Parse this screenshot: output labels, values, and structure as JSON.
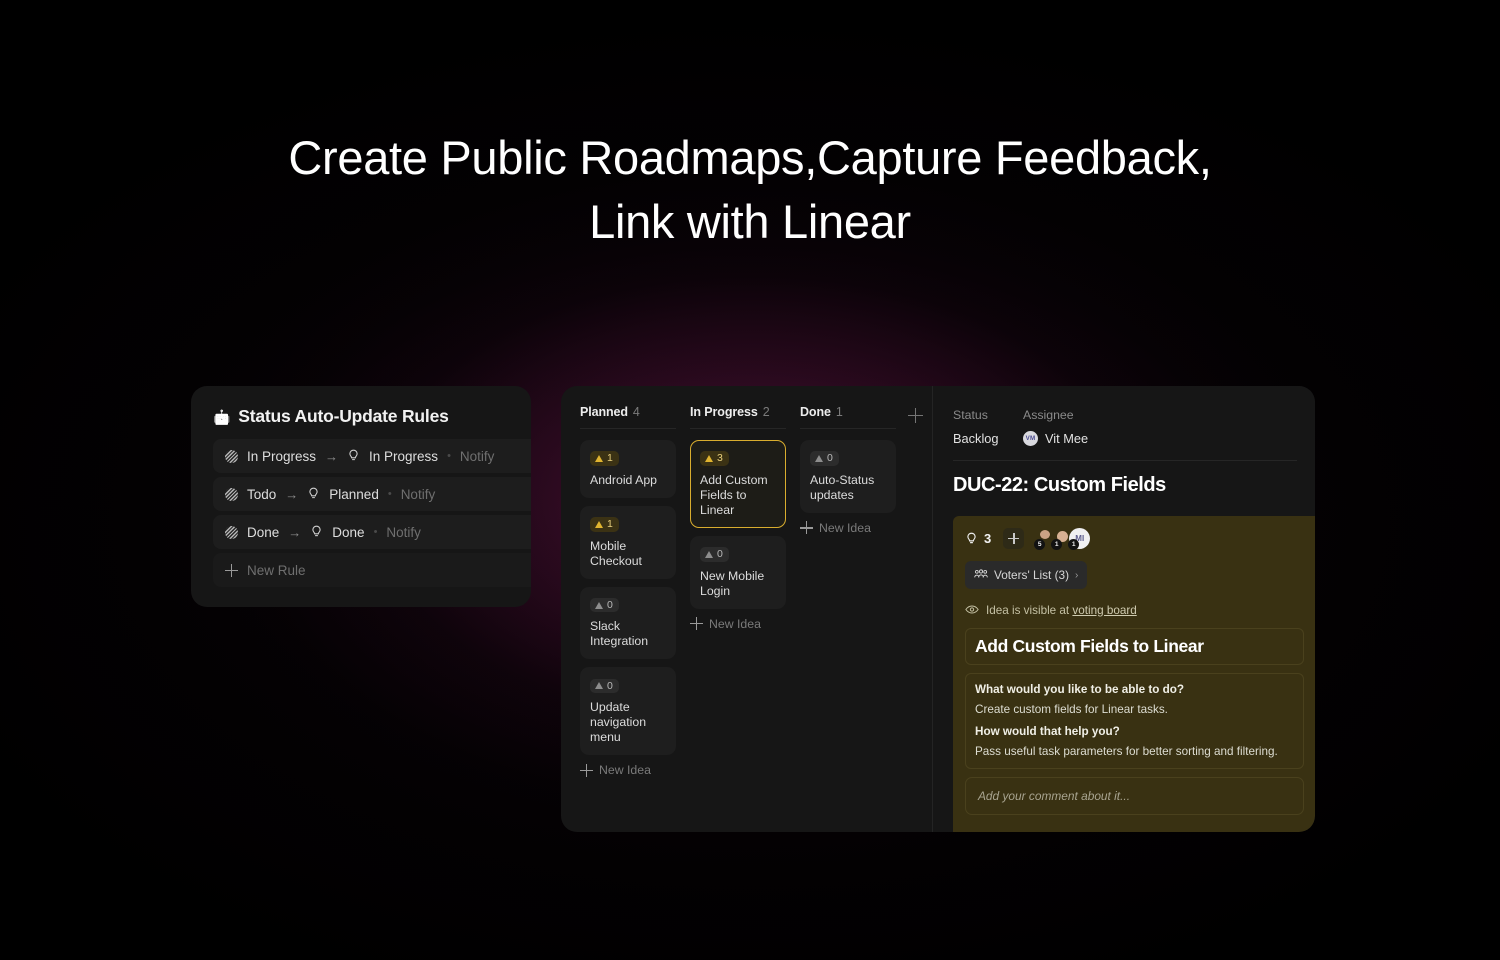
{
  "headline": {
    "line1": "Create Public Roadmaps,Capture Feedback,",
    "line2": "Link with Linear"
  },
  "rules_panel": {
    "title": "Status Auto-Update Rules",
    "title_icon": "robot-icon",
    "rows": [
      {
        "from": "In Progress",
        "arrow": "→",
        "to": "In Progress",
        "dot": "•",
        "notify": "Notify"
      },
      {
        "from": "Todo",
        "arrow": "→",
        "to": "Planned",
        "dot": "•",
        "notify": "Notify"
      },
      {
        "from": "Done",
        "arrow": "→",
        "to": "Done",
        "dot": "•",
        "notify": "Notify"
      }
    ],
    "new_rule": "New Rule"
  },
  "board": {
    "add_column_icon": "plus-icon",
    "new_idea_label": "New Idea",
    "columns": [
      {
        "name": "Planned",
        "count": "4",
        "cards": [
          {
            "votes": "1",
            "hot": true,
            "title": "Android App"
          },
          {
            "votes": "1",
            "hot": true,
            "title": "Mobile Checkout"
          },
          {
            "votes": "0",
            "hot": false,
            "title": "Slack Integration"
          },
          {
            "votes": "0",
            "hot": false,
            "title": "Update navigation menu"
          }
        ]
      },
      {
        "name": "In Progress",
        "count": "2",
        "cards": [
          {
            "votes": "3",
            "hot": true,
            "title": "Add Custom Fields to Linear",
            "selected": true
          },
          {
            "votes": "0",
            "hot": false,
            "title": "New Mobile Login"
          }
        ]
      },
      {
        "name": "Done",
        "count": "1",
        "cards": [
          {
            "votes": "0",
            "hot": false,
            "title": "Auto-Status updates"
          }
        ]
      }
    ]
  },
  "detail": {
    "status_label": "Status",
    "assignee_label": "Assignee",
    "status_value": "Backlog",
    "assignee_name": "Vit Mee",
    "assignee_initials": "VM",
    "ticket_title": "DUC-22: Custom Fields",
    "vote_count": "3",
    "avatars": [
      {
        "initials": "",
        "badge": "5"
      },
      {
        "initials": "",
        "badge": "1"
      },
      {
        "initials": "MI",
        "badge": "1"
      }
    ],
    "voters_button": "Voters' List (3)",
    "voters_chevron": "›",
    "visibility_prefix": "Idea is visible at",
    "visibility_link": "voting board",
    "idea_title": "Add Custom Fields to Linear",
    "q1": "What would you like to be able to do?",
    "a1": "Create custom fields for Linear tasks.",
    "q2": "How would that help you?",
    "a2": "Pass useful task parameters for better sorting and filtering.",
    "comment_placeholder": "Add your comment about it..."
  },
  "colors": {
    "accent_yellow": "#d9ad2e",
    "highlight_bg": "#393112",
    "panel_bg": "#161616",
    "glow": "#7a1c56"
  }
}
